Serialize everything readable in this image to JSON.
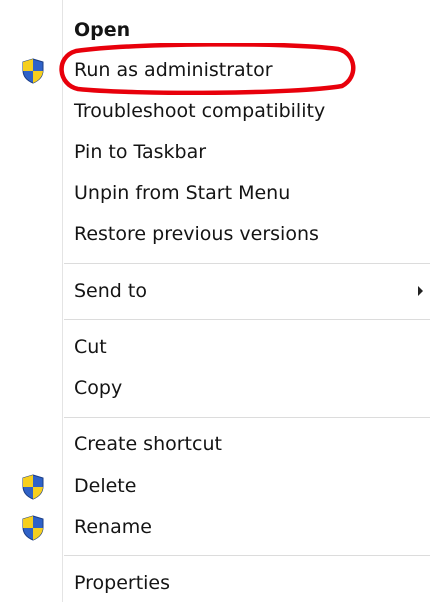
{
  "menu": {
    "items": [
      {
        "label": "Open"
      },
      {
        "label": "Run as administrator"
      },
      {
        "label": "Troubleshoot compatibility"
      },
      {
        "label": "Pin to Taskbar"
      },
      {
        "label": "Unpin from Start Menu"
      },
      {
        "label": "Restore previous versions"
      },
      {
        "label": "Send to"
      },
      {
        "label": "Cut"
      },
      {
        "label": "Copy"
      },
      {
        "label": "Create shortcut"
      },
      {
        "label": "Delete"
      },
      {
        "label": "Rename"
      },
      {
        "label": "Properties"
      }
    ]
  },
  "icons": {
    "uac_shield": "uac-shield-icon",
    "submenu": "chevron-right-icon"
  },
  "colors": {
    "highlight_circle": "#e8000b",
    "shield_blue": "#2f62c8",
    "shield_yellow": "#f6cf1e"
  }
}
